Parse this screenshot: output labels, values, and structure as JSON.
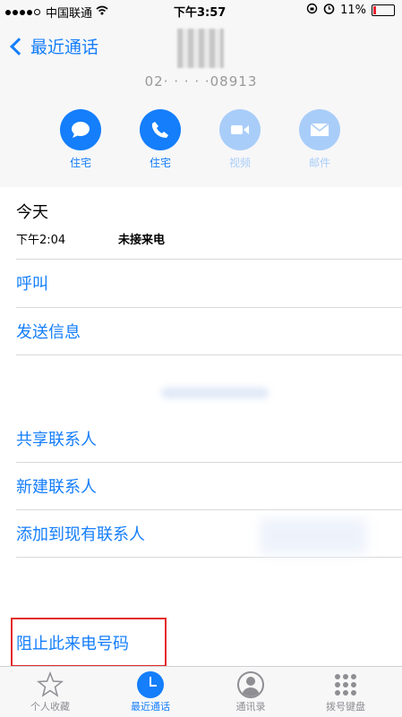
{
  "status": {
    "carrier": "中国联通",
    "time": "下午3:57",
    "battery": "11%"
  },
  "header": {
    "back_label": "最近通话",
    "number": "02· · · · ·08913"
  },
  "actions": [
    {
      "label": "住宅",
      "icon": "message-icon",
      "enabled": true
    },
    {
      "label": "住宅",
      "icon": "phone-icon",
      "enabled": true
    },
    {
      "label": "视频",
      "icon": "video-icon",
      "enabled": false
    },
    {
      "label": "邮件",
      "icon": "mail-icon",
      "enabled": false
    }
  ],
  "call": {
    "day": "今天",
    "time": "下午2:04",
    "type": "未接来电"
  },
  "menu": {
    "call": "呼叫",
    "message": "发送信息",
    "share": "共享联系人",
    "new": "新建联系人",
    "add_existing": "添加到现有联系人",
    "block": "阻止此来电号码"
  },
  "tabs": [
    {
      "label": "个人收藏",
      "icon": "star-icon"
    },
    {
      "label": "最近通话",
      "icon": "clock-icon"
    },
    {
      "label": "通讯录",
      "icon": "contacts-icon"
    },
    {
      "label": "拨号键盘",
      "icon": "keypad-icon"
    }
  ],
  "colors": {
    "accent": "#147efb",
    "highlight_box": "#e32a2a"
  }
}
